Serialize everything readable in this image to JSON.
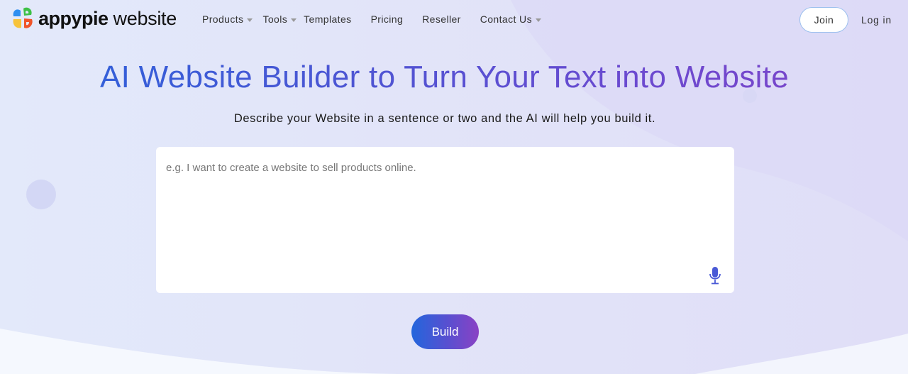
{
  "header": {
    "logo_brand": "appypie",
    "logo_product": "website",
    "nav": [
      {
        "label": "Products",
        "has_dropdown": true
      },
      {
        "label": "Tools",
        "has_dropdown": true
      },
      {
        "label": "Templates",
        "has_dropdown": false
      },
      {
        "label": "Pricing",
        "has_dropdown": false
      },
      {
        "label": "Reseller",
        "has_dropdown": false
      },
      {
        "label": "Contact Us",
        "has_dropdown": true
      }
    ],
    "join_label": "Join",
    "login_label": "Log in"
  },
  "hero": {
    "title": "AI Website Builder to Turn Your Text into Website",
    "subtitle": "Describe your Website in a sentence or two and the AI will help you build it."
  },
  "prompt": {
    "value": "",
    "placeholder": "e.g. I want to create a website to sell products online.",
    "mic_icon": "microphone-icon"
  },
  "build_label": "Build",
  "colors": {
    "title_gradient_start": "#2a63db",
    "title_gradient_end": "#7e45c8",
    "button_gradient_start": "#2366dc",
    "button_gradient_end": "#8a42c4",
    "mic": "#4a5ad6",
    "join_border": "#9cc0ee"
  }
}
